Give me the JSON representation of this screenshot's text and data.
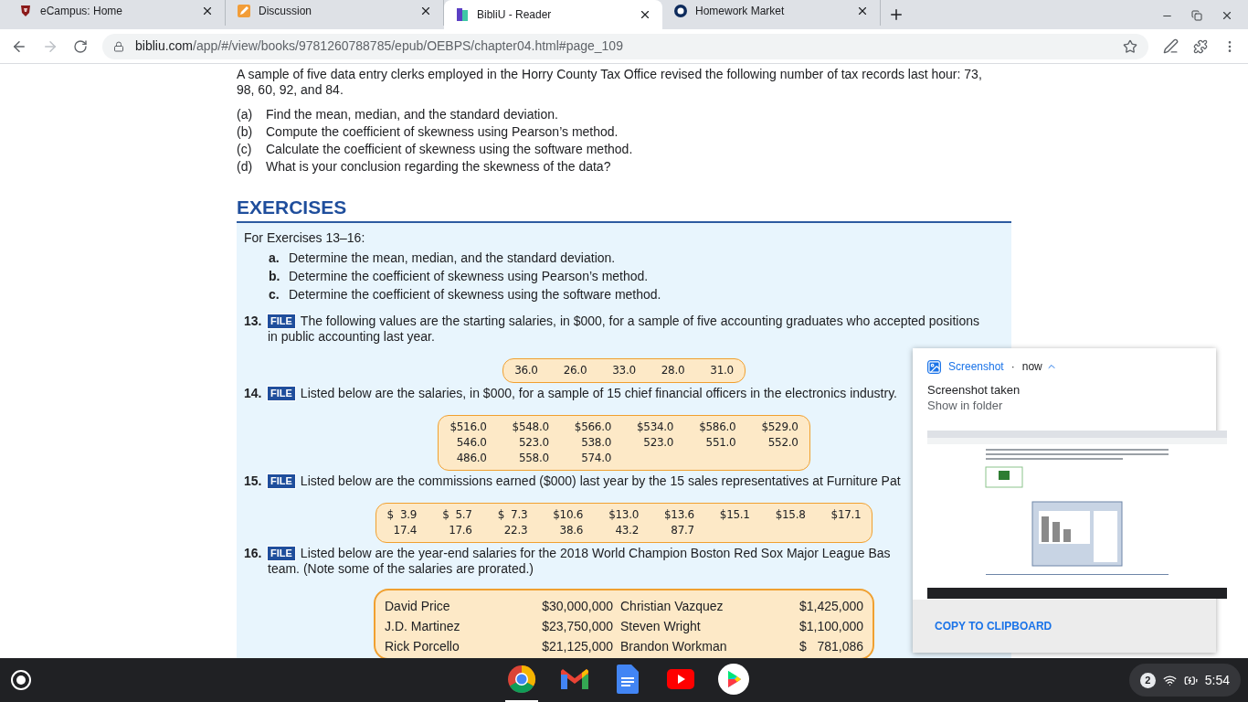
{
  "tabs": [
    {
      "title": "eCampus: Home",
      "kind": "ecampus",
      "selected": false
    },
    {
      "title": "Discussion",
      "kind": "discussion",
      "selected": false
    },
    {
      "title": "BibliU - Reader",
      "kind": "bibliu",
      "selected": true
    },
    {
      "title": "Homework Market",
      "kind": "market",
      "selected": false
    }
  ],
  "address_bar": {
    "host": "bibliu.com",
    "path": "/app/#/view/books/9781260788785/epub/OEBPS/chapter04.html#page_109"
  },
  "intro": {
    "lines": [
      "A sample of five data entry clerks employed in the Horry County Tax Office revised the following number of tax records last hour: 73,",
      "98, 60, 92, and 84."
    ],
    "items": [
      {
        "label": "(a)",
        "text": "Find the mean, median, and the standard deviation."
      },
      {
        "label": "(b)",
        "text": "Compute the coefficient of skewness using Pearson’s method."
      },
      {
        "label": "(c)",
        "text": "Calculate the coefficient of skewness using the software method."
      },
      {
        "label": "(d)",
        "text": "What is your conclusion regarding the skewness of the data?"
      }
    ]
  },
  "exercises_heading": "EXERCISES",
  "exercises_box": {
    "lead": "For Exercises 13–16:",
    "tasks": [
      {
        "label": "a.",
        "text": "Determine the mean, median, and the standard deviation."
      },
      {
        "label": "b.",
        "text": "Determine the coefficient of skewness using Pearson’s method."
      },
      {
        "label": "c.",
        "text": "Determine the coefficient of skewness using the software method."
      }
    ],
    "exercises": [
      {
        "number": "13.",
        "badge": "FILE",
        "lines": [
          "The following values are the starting salaries, in $000, for a sample of five accounting graduates who accepted positions",
          "in public accounting last year."
        ],
        "table": {
          "kind": "numbers",
          "rows": [
            [
              "36.0",
              "26.0",
              "33.0",
              "28.0",
              "31.0"
            ]
          ]
        }
      },
      {
        "number": "14.",
        "badge": "FILE",
        "lines": [
          "Listed below are the salaries, in $000, for a sample of 15 chief financial officers in the electronics industry."
        ],
        "table": {
          "kind": "numbers",
          "rows": [
            [
              "$516.0",
              "$548.0",
              "$566.0",
              "$534.0",
              "$586.0",
              "$529.0"
            ],
            [
              "546.0",
              "523.0",
              "538.0",
              "523.0",
              "551.0",
              "552.0"
            ],
            [
              "486.0",
              "558.0",
              "574.0"
            ]
          ]
        }
      },
      {
        "number": "15.",
        "badge": "FILE",
        "lines": [
          "Listed below are the commissions earned ($000) last year by the 15 sales representatives at Furniture Pat"
        ],
        "table": {
          "kind": "numbers",
          "rows": [
            [
              "$  3.9",
              "$  5.7",
              "$  7.3",
              "$10.6",
              "$13.0",
              "$13.6",
              "$15.1",
              "$15.8",
              "$17.1"
            ],
            [
              "17.4",
              "17.6",
              "22.3",
              "38.6",
              "43.2",
              "87.7"
            ]
          ]
        }
      },
      {
        "number": "16.",
        "badge": "FILE",
        "lines": [
          "Listed below are the year-end salaries for the 2018 World Champion Boston Red Sox Major League Bas",
          "team. (Note some of the salaries are prorated.)"
        ],
        "table": {
          "kind": "salaries",
          "rows": [
            [
              "David Price",
              "$30,000,000",
              "Christian Vazquez",
              "$1,425,000"
            ],
            [
              "J.D. Martinez",
              "$23,750,000",
              "Steven Wright",
              "$1,100,000"
            ],
            [
              "Rick Porcello",
              "$21,125,000",
              "Brandon Workman",
              "$   781,086"
            ]
          ]
        }
      }
    ]
  },
  "notification": {
    "app": "Screenshot",
    "separator": "·",
    "time": "now",
    "title": "Screenshot taken",
    "subtitle": "Show in folder",
    "action": "COPY TO CLIPBOARD"
  },
  "shelf": {
    "apps": [
      {
        "kind": "chrome",
        "active": true
      },
      {
        "kind": "gmail",
        "active": false
      },
      {
        "kind": "docs",
        "active": false
      },
      {
        "kind": "youtube",
        "active": false
      },
      {
        "kind": "play",
        "active": false
      }
    ],
    "notification_count": "2",
    "time": "5:54"
  }
}
